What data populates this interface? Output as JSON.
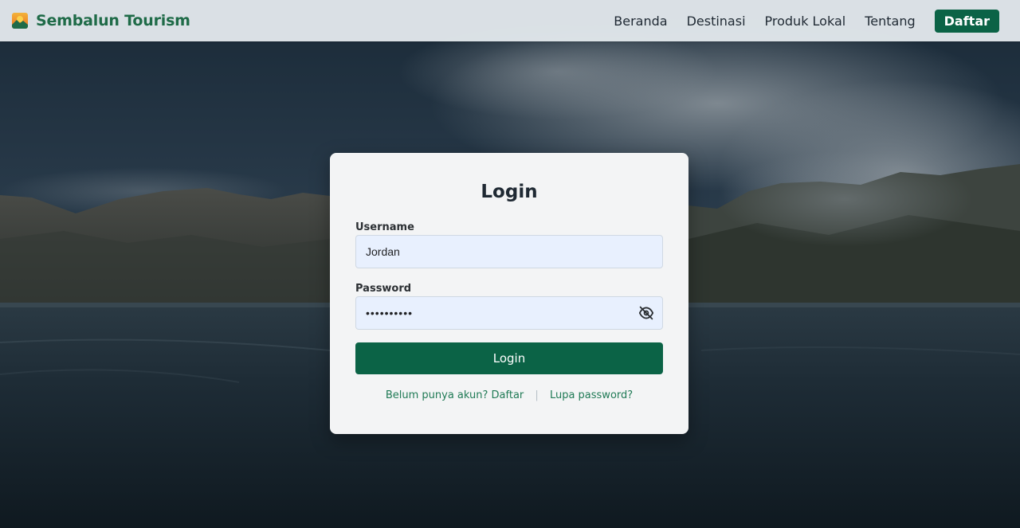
{
  "navbar": {
    "brand_name": "Sembalun Tourism",
    "links": [
      {
        "label": "Beranda"
      },
      {
        "label": "Destinasi"
      },
      {
        "label": "Produk Lokal"
      },
      {
        "label": "Tentang"
      }
    ],
    "cta_label": "Daftar"
  },
  "login": {
    "title": "Login",
    "username_label": "Username",
    "username_value": "Jordan",
    "password_label": "Password",
    "password_masked": "••••••••••",
    "submit_label": "Login",
    "register_link": "Belum punya akun? Daftar",
    "separator": "|",
    "forgot_link": "Lupa password?"
  },
  "icons": {
    "brand": "landscape-logo-icon",
    "password_toggle": "eye-off-icon"
  },
  "colors": {
    "brand_green": "#0b6346",
    "brand_text": "#1f6b48",
    "link_green": "#1f7a55",
    "input_bg": "#e8f0fe"
  }
}
